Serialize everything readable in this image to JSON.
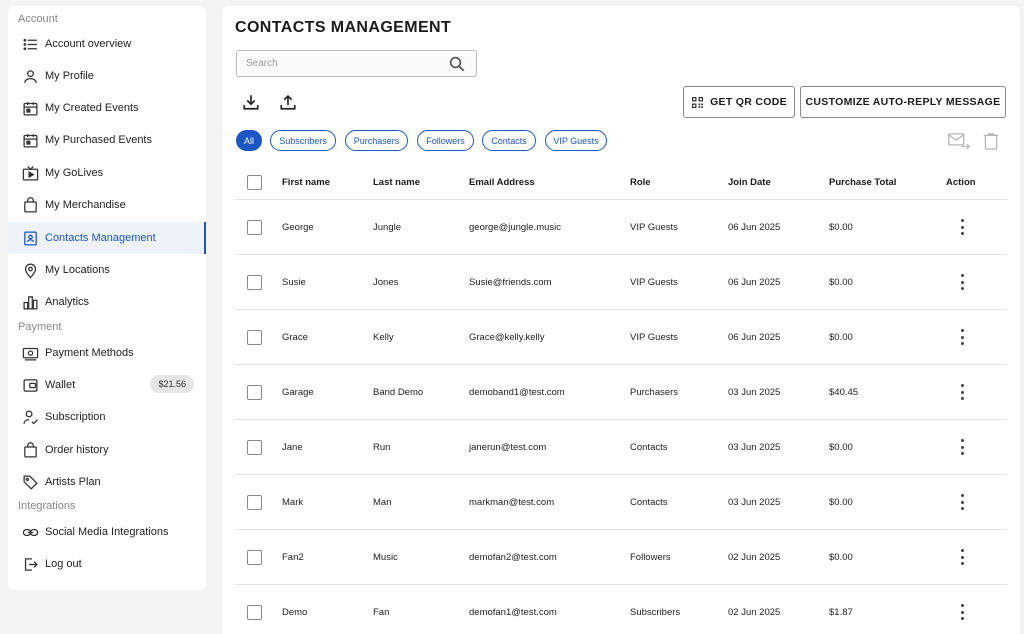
{
  "sidebar": {
    "sections": {
      "account": "Account",
      "payment": "Payment",
      "integrations": "Integrations"
    },
    "items": [
      {
        "label": "Account overview",
        "icon": "list-icon"
      },
      {
        "label": "My Profile",
        "icon": "person-icon"
      },
      {
        "label": "My Created Events",
        "icon": "calendar-icon"
      },
      {
        "label": "My Purchased Events",
        "icon": "calendar-icon"
      },
      {
        "label": "My GoLives",
        "icon": "tv-play-icon"
      },
      {
        "label": "My Merchandise",
        "icon": "shopping-bag-icon"
      },
      {
        "label": "Contacts Management",
        "icon": "contact-card-icon",
        "active": true
      },
      {
        "label": "My Locations",
        "icon": "location-pin-icon"
      },
      {
        "label": "Analytics",
        "icon": "bar-chart-icon"
      },
      {
        "label": "Payment Methods",
        "icon": "payment-card-icon"
      },
      {
        "label": "Wallet",
        "icon": "wallet-icon",
        "badge": "$21.56"
      },
      {
        "label": "Subscription",
        "icon": "person-check-icon"
      },
      {
        "label": "Order history",
        "icon": "shopping-bag-icon"
      },
      {
        "label": "Artists Plan",
        "icon": "tag-icon"
      },
      {
        "label": "Social Media Integrations",
        "icon": "link-icon"
      },
      {
        "label": "Log out",
        "icon": "logout-icon"
      }
    ]
  },
  "main": {
    "title": "CONTACTS MANAGEMENT",
    "search_placeholder": "Search",
    "qr_button": "GET QR CODE",
    "auto_reply_button": "CUSTOMIZE AUTO-REPLY MESSAGE",
    "filters": [
      "All",
      "Subscribers",
      "Purchasers",
      "Followers",
      "Contacts",
      "VIP Guests"
    ],
    "active_filter": "All",
    "columns": [
      "First name",
      "Last name",
      "Email Address",
      "Role",
      "Join Date",
      "Purchase Total",
      "Action"
    ],
    "rows": [
      {
        "first": "George",
        "last": "Jungle",
        "email": "george@jungle.music",
        "role": "VIP Guests",
        "date": "06 Jun 2025",
        "total": "$0.00"
      },
      {
        "first": "Susie",
        "last": "Jones",
        "email": "Susie@friends.com",
        "role": "VIP Guests",
        "date": "06 Jun 2025",
        "total": "$0.00"
      },
      {
        "first": "Grace",
        "last": "Kelly",
        "email": "Grace@kelly.kelly",
        "role": "VIP Guests",
        "date": "06 Jun 2025",
        "total": "$0.00"
      },
      {
        "first": "Garage",
        "last": "Band Demo",
        "email": "demoband1@test.com",
        "role": "Purchasers",
        "date": "03 Jun 2025",
        "total": "$40.45"
      },
      {
        "first": "Jane",
        "last": "Run",
        "email": "janerun@test.com",
        "role": "Contacts",
        "date": "03 Jun 2025",
        "total": "$0.00"
      },
      {
        "first": "Mark",
        "last": "Man",
        "email": "markman@test.com",
        "role": "Contacts",
        "date": "03 Jun 2025",
        "total": "$0.00"
      },
      {
        "first": "Fan2",
        "last": "Music",
        "email": "demofan2@test.com",
        "role": "Followers",
        "date": "02 Jun 2025",
        "total": "$0.00"
      },
      {
        "first": "Demo",
        "last": "Fan",
        "email": "demofan1@test.com",
        "role": "Subscribers",
        "date": "02 Jun 2025",
        "total": "$1.87"
      }
    ]
  },
  "colors": {
    "accent": "#1a56c4",
    "active_bg": "#eef3fb",
    "page_bg": "#f3f3f3"
  }
}
